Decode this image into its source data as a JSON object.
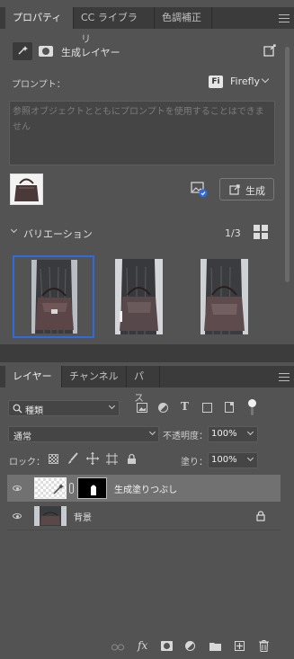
{
  "properties_panel": {
    "tabs": [
      "プロパティ",
      "CC ライブラリ",
      "色調補正"
    ],
    "layer_type_label": "生成レイヤー",
    "prompt_label": "プロンプト：",
    "model_label": "Firefly",
    "model_badge": "Fi",
    "prompt_placeholder": "参照オブジェクトとともにプロンプトを使用することはできません",
    "generate_button": "生成",
    "variations_label": "バリエーション",
    "variation_counter": "1/3",
    "variations_selected_index": 0
  },
  "layers_panel": {
    "tabs": [
      "レイヤー",
      "チャンネル",
      "パス"
    ],
    "filter_label": "種類",
    "blend_mode": "通常",
    "opacity_label": "不透明度：",
    "opacity_value": "100%",
    "lock_label": "ロック：",
    "fill_label": "塗り：",
    "fill_value": "100%",
    "layers": [
      {
        "name": "生成塗りつぶし",
        "visible": true,
        "selected": true
      },
      {
        "name": "背景",
        "visible": true,
        "selected": false,
        "locked": true
      }
    ],
    "footer_icons": [
      "link-icon",
      "fx-icon",
      "mask-icon",
      "adjustment-icon",
      "folder-icon",
      "new-layer-icon",
      "trash-icon"
    ],
    "fx_label": "fx"
  },
  "colors": {
    "accent": "#2d6be0",
    "panel_bg": "#535353",
    "tab_bar_bg": "#3b3b3b"
  }
}
